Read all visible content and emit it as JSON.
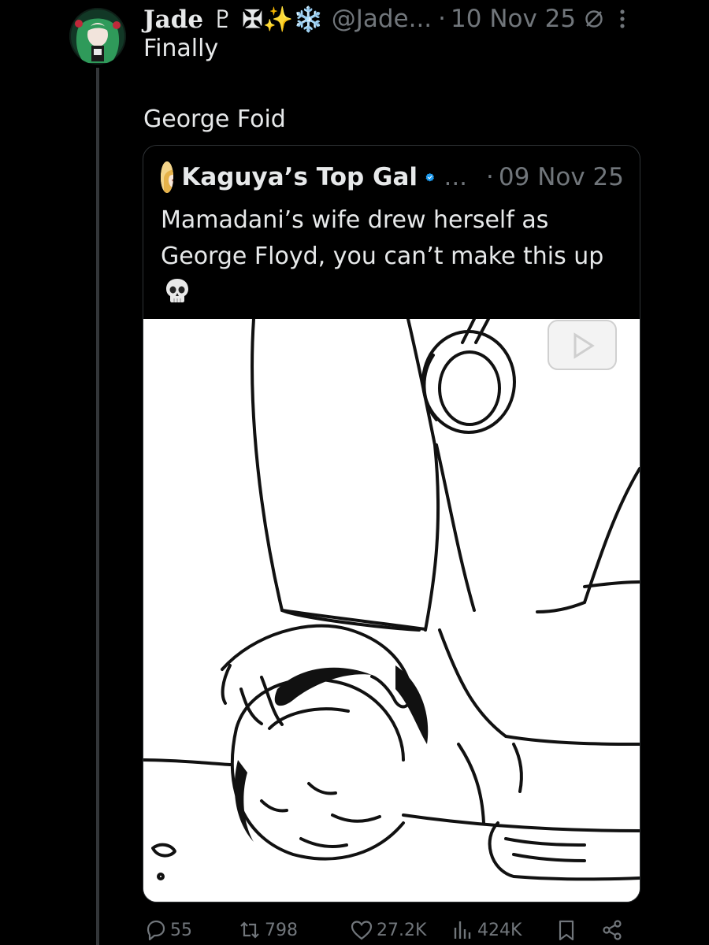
{
  "post": {
    "author_display_name": "Jade ♇ ✠✨❄️",
    "author_handle": "@Jade...",
    "dot": "·",
    "date": "10 Nov 25",
    "text_line1": "Finally",
    "text_line2": "George Foid"
  },
  "quoted": {
    "author_name": "Kaguya’s Top Gal",
    "ellipsis": "...",
    "dot": "·",
    "date": "09 Nov 25",
    "text": "Mamadani’s wife drew herself as George Floyd, you can’t make this up",
    "emoji": "skull-emoji",
    "media": "line-drawing-illustration"
  },
  "actions": {
    "replies": "55",
    "reposts": "798",
    "likes": "27.2K",
    "views": "424K"
  },
  "colors": {
    "background": "#000000",
    "text": "#e7e9ea",
    "muted": "#71767b",
    "border": "#2f3336",
    "verified": "#1d9bf0"
  }
}
